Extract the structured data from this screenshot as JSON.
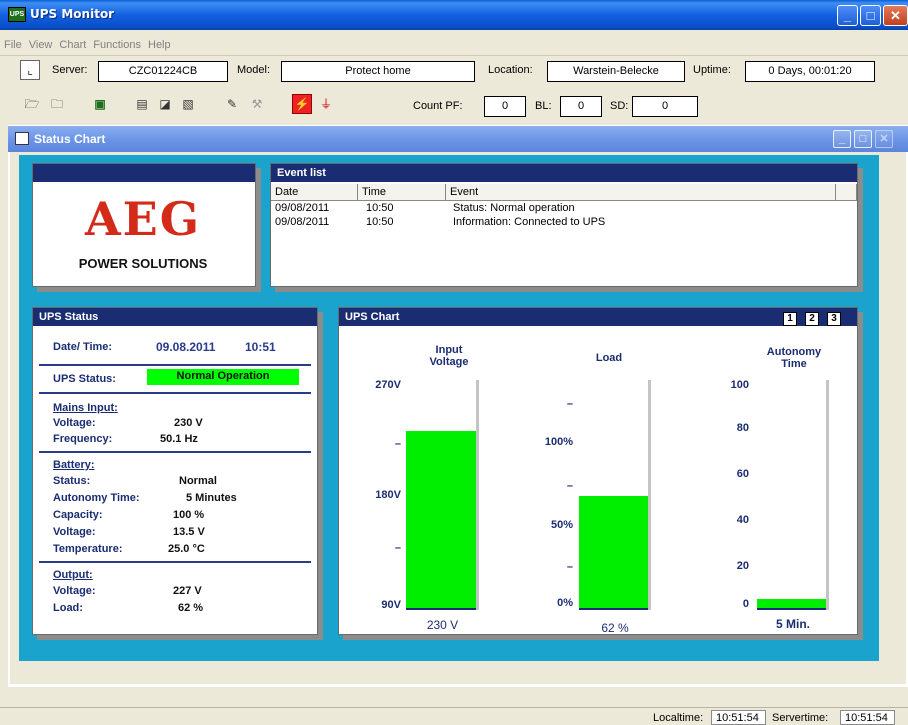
{
  "window": {
    "title": "UPS Monitor",
    "icon_text": "UPS"
  },
  "menu": [
    "File",
    "View",
    "Chart",
    "Functions",
    "Help"
  ],
  "info": {
    "server_label": "Server:",
    "server": "CZC01224CB",
    "model_label": "Model:",
    "model": "Protect home",
    "location_label": "Location:",
    "location": "Warstein-Belecke",
    "uptime_label": "Uptime:",
    "uptime": "0 Days, 00:01:20"
  },
  "toolbar": {
    "count_pf_label": "Count PF:",
    "count_pf": "0",
    "bl_label": "BL:",
    "bl": "0",
    "sd_label": "SD:",
    "sd": "0"
  },
  "child": {
    "title": "Status Chart"
  },
  "logo": {
    "brand": "AEG",
    "sub": "POWER SOLUTIONS"
  },
  "events": {
    "title": "Event list",
    "columns": [
      "Date",
      "Time",
      "Event"
    ],
    "rows": [
      [
        "09/08/2011",
        "10:50",
        "Status: Normal operation"
      ],
      [
        "09/08/2011",
        "10:50",
        "Information: Connected to UPS"
      ]
    ]
  },
  "status": {
    "title": "UPS Status",
    "datetime_label": "Date/ Time:",
    "date": "09.08.2011",
    "time": "10:51",
    "ups_status_label": "UPS Status:",
    "ups_status": "Normal Operation",
    "status_color": "#00ff00",
    "mains_title": "Mains Input:",
    "mains_voltage_label": "Voltage:",
    "mains_voltage": "230 V",
    "frequency_label": "Frequency:",
    "frequency": "50.1 Hz",
    "battery_title": "Battery:",
    "battery_status_label": "Status:",
    "battery_status": "Normal",
    "autonomy_label": "Autonomy Time:",
    "autonomy": "5 Minutes",
    "capacity_label": "Capacity:",
    "capacity": "100 %",
    "battery_voltage_label": "Voltage:",
    "battery_voltage": "13.5 V",
    "temperature_label": "Temperature:",
    "temperature": "25.0 °C",
    "output_title": "Output:",
    "output_voltage_label": "Voltage:",
    "output_voltage": "227 V",
    "load_label": "Load:",
    "load": "62 %"
  },
  "chart": {
    "title": "UPS Chart",
    "pages": [
      "1",
      "2",
      "3"
    ],
    "bar_color": "#00ee00"
  },
  "chart_data": {
    "type": "bar",
    "categories": [
      "Input Voltage",
      "Load",
      "Autonomy Time"
    ],
    "series": [
      {
        "category": "Input Voltage",
        "value": 230,
        "unit": "V",
        "ylim": [
          90,
          270
        ],
        "ticks": [
          "270V",
          "180V",
          "90V"
        ],
        "label": "230 V",
        "title_lines": [
          "Input",
          "Voltage"
        ]
      },
      {
        "category": "Load",
        "value": 62,
        "unit": "%",
        "ylim": [
          0,
          125
        ],
        "ticks": [
          "100%",
          "50%",
          "0%"
        ],
        "label": "62 %",
        "title_lines": [
          "Load"
        ]
      },
      {
        "category": "Autonomy Time",
        "value": 5,
        "unit": "Min",
        "ylim": [
          0,
          100
        ],
        "ticks": [
          "100",
          "80",
          "60",
          "40",
          "20",
          "0"
        ],
        "label": "5 Min.",
        "title_lines": [
          "Autonomy",
          "Time"
        ]
      }
    ]
  },
  "statusbar": {
    "localtime_label": "Localtime:",
    "localtime": "10:51:54",
    "servertime_label": "Servertime:",
    "servertime": "10:51:54"
  }
}
